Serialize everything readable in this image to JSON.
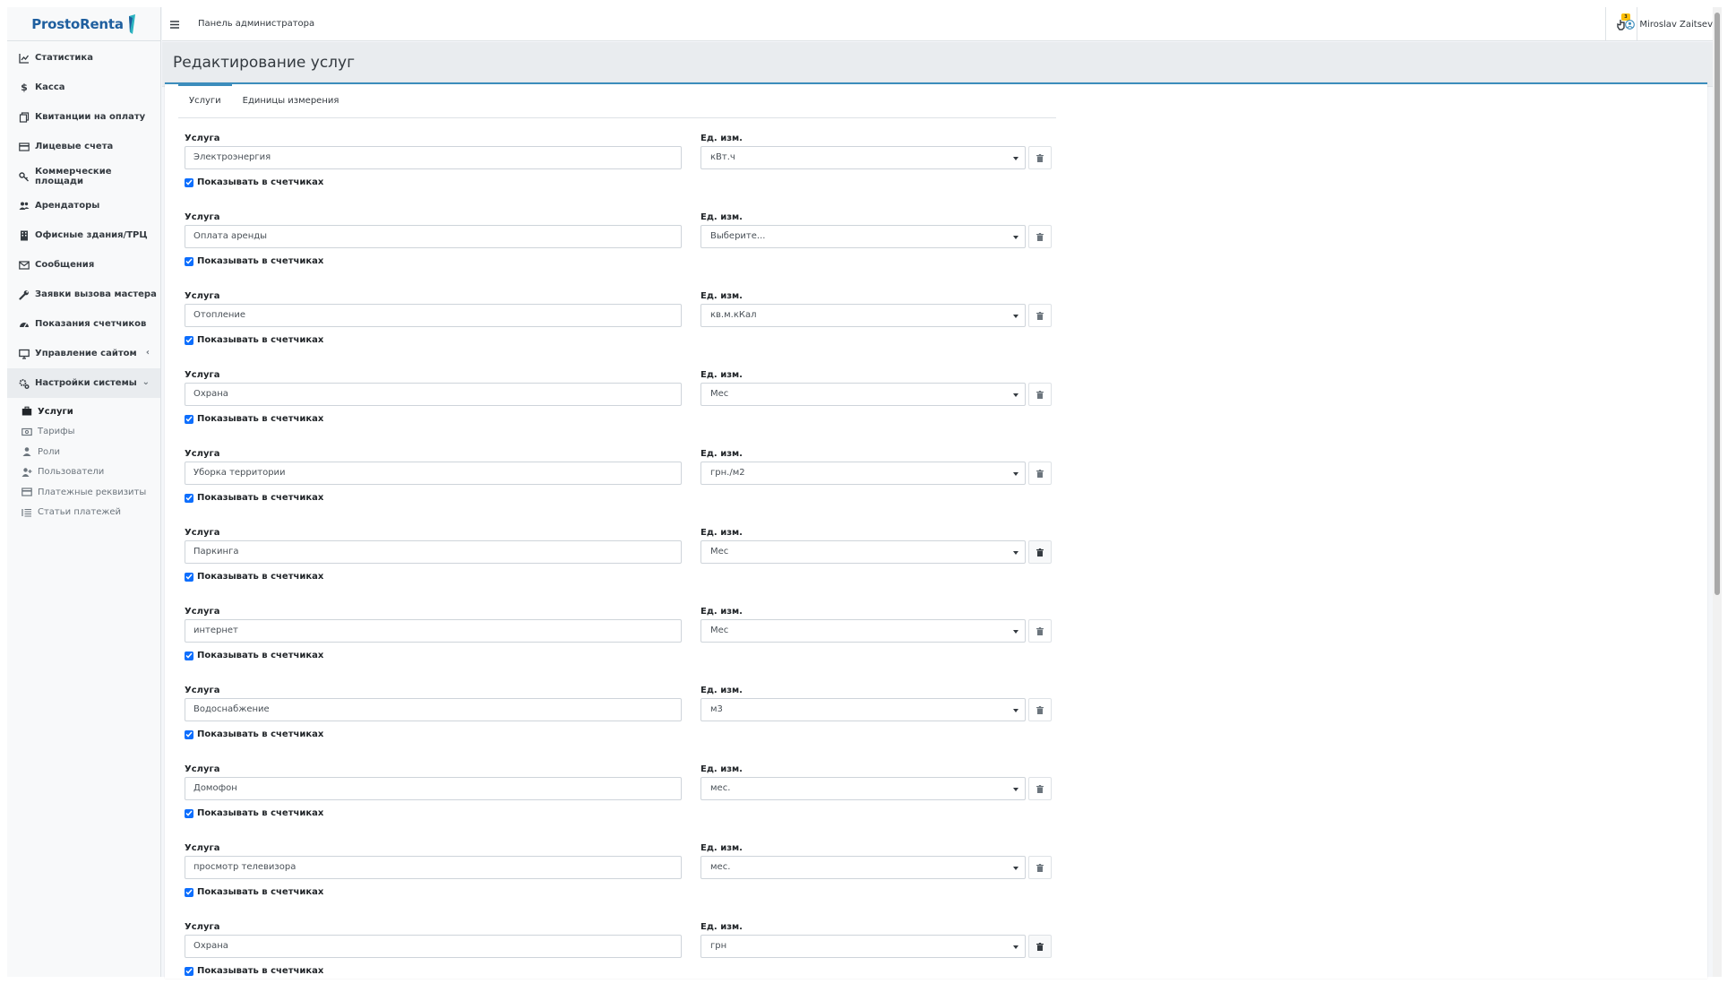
{
  "brand": {
    "name": "ProstoRenta"
  },
  "header": {
    "title": "Панель администратора",
    "notifications_count": "3",
    "user_name": "Miroslav Zaitsev"
  },
  "sidebar": {
    "items": [
      {
        "label": "Статистика",
        "icon": "chart-line-icon"
      },
      {
        "label": "Касса",
        "icon": "dollar-icon"
      },
      {
        "label": "Квитанции на оплату",
        "icon": "copy-icon"
      },
      {
        "label": "Лицевые счета",
        "icon": "credit-card-icon"
      },
      {
        "label": "Коммерческие площади",
        "icon": "key-icon"
      },
      {
        "label": "Арендаторы",
        "icon": "users-icon"
      },
      {
        "label": "Офисные здания/ТРЦ",
        "icon": "building-icon"
      },
      {
        "label": "Сообщения",
        "icon": "envelope-icon"
      },
      {
        "label": "Заявки вызова мастера",
        "icon": "wrench-icon"
      },
      {
        "label": "Показания счетчиков",
        "icon": "gauge-icon"
      },
      {
        "label": "Управление сайтом",
        "icon": "desktop-icon"
      },
      {
        "label": "Настройки системы",
        "icon": "cogs-icon"
      }
    ],
    "sub_items": [
      {
        "label": "Услуги",
        "icon": "briefcase-icon"
      },
      {
        "label": "Тарифы",
        "icon": "money-icon"
      },
      {
        "label": "Роли",
        "icon": "user-icon"
      },
      {
        "label": "Пользователи",
        "icon": "user-plus-icon"
      },
      {
        "label": "Платежные реквизиты",
        "icon": "credit-card-icon"
      },
      {
        "label": "Статьи платежей",
        "icon": "list-icon"
      }
    ]
  },
  "page": {
    "title": "Редактирование услуг"
  },
  "tabs": [
    {
      "label": "Услуги"
    },
    {
      "label": "Единицы измерения"
    }
  ],
  "form": {
    "service_label": "Услуга",
    "unit_label": "Ед. изм.",
    "show_in_meters_label": "Показывать в счетчиках",
    "rows": [
      {
        "service": "Электроэнергия",
        "unit": "кВт.ч",
        "show_in_meters": true
      },
      {
        "service": "Оплата аренды",
        "unit": "Выберите...",
        "show_in_meters": true
      },
      {
        "service": "Отопление",
        "unit": "кв.м.кКал",
        "show_in_meters": true
      },
      {
        "service": "Охрана",
        "unit": "Мес",
        "show_in_meters": true
      },
      {
        "service": "Уборка территории",
        "unit": "грн./м2",
        "show_in_meters": true
      },
      {
        "service": "Паркинга",
        "unit": "Мес",
        "show_in_meters": true
      },
      {
        "service": "интернет",
        "unit": "Мес",
        "show_in_meters": true
      },
      {
        "service": "Водоснабжение",
        "unit": "м3",
        "show_in_meters": true
      },
      {
        "service": "Домофон",
        "unit": "мес.",
        "show_in_meters": true
      },
      {
        "service": "просмотр телевизора",
        "unit": "мес.",
        "show_in_meters": true
      },
      {
        "service": "Охрана",
        "unit": "грн",
        "show_in_meters": true
      }
    ]
  },
  "colors": {
    "brand": "#1f5f9f",
    "accent": "#3c8dbc",
    "checkbox": "#0d6efd",
    "badge": "#ffc107"
  }
}
